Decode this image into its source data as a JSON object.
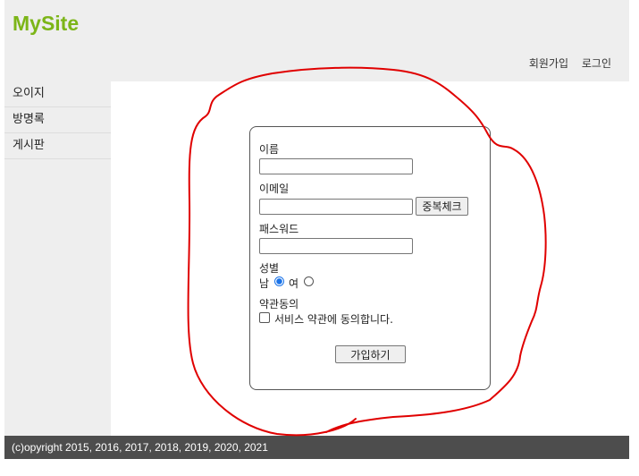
{
  "header": {
    "logo": "MySite",
    "links": {
      "join": "회원가입",
      "login": "로그인"
    }
  },
  "sidebar": {
    "items": [
      {
        "label": "오이지"
      },
      {
        "label": "방명록"
      },
      {
        "label": "게시판"
      }
    ]
  },
  "form": {
    "name_label": "이름",
    "name_value": "",
    "email_label": "이메일",
    "email_value": "",
    "dup_check_label": "중복체크",
    "password_label": "패스워드",
    "password_value": "",
    "gender_label": "성별",
    "gender_male": "남",
    "gender_female": "여",
    "gender_selected": "남",
    "terms_label": "약관동의",
    "terms_text": "서비스 약관에 동의합니다.",
    "terms_checked": false,
    "submit_label": "가입하기"
  },
  "footer": {
    "copyright": "(c)opyright 2015, 2016, 2017, 2018, 2019, 2020, 2021"
  },
  "colors": {
    "logo": "#7cb518",
    "annotation": "#e00000",
    "footer_bg": "#4d4d4d"
  }
}
